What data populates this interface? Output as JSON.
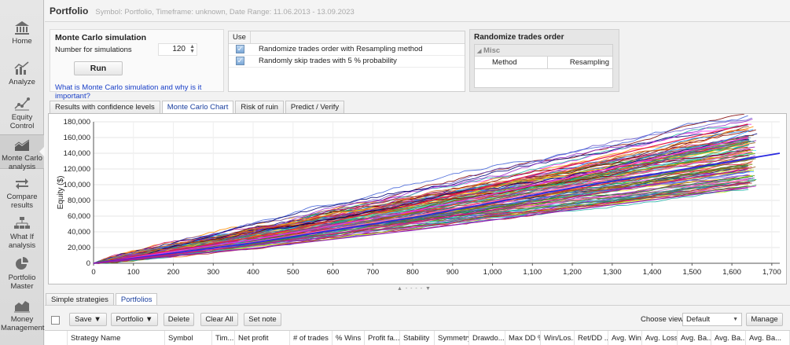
{
  "header": {
    "title": "Portfolio",
    "subtitle": "Symbol: Portfolio, Timeframe: unknown, Date Range: 11.06.2013 - 13.09.2023"
  },
  "sidebar": {
    "items": [
      {
        "label": "Home",
        "icon": "home-icon"
      },
      {
        "label": "Analyze",
        "icon": "analyze-chart-icon"
      },
      {
        "label": "Equity Control",
        "icon": "equity-control-icon"
      },
      {
        "label": "Monte Carlo analysis",
        "icon": "monte-carlo-icon",
        "active": true
      },
      {
        "label": "Compare results",
        "icon": "compare-icon"
      },
      {
        "label": "What If analysis",
        "icon": "what-if-icon"
      },
      {
        "label": "Portfolio Master",
        "icon": "pie-chart-icon"
      },
      {
        "label": "Money Management",
        "icon": "money-management-icon"
      }
    ]
  },
  "mc_panel": {
    "title": "Monte Carlo simulation",
    "sim_label": "Number for simulations",
    "sim_value": "120",
    "run_label": "Run",
    "link_text": "What is Monte Carlo simulation and why is it important?"
  },
  "use_panel": {
    "header": "Use",
    "options": [
      {
        "label": "Randomize trades order with Resampling method",
        "checked": true
      },
      {
        "label": "Randomly skip trades with 5 % probability",
        "checked": true
      }
    ]
  },
  "randomize_panel": {
    "title": "Randomize trades order",
    "group": "Misc",
    "property": "Method",
    "value": "Resampling"
  },
  "chart_tabs": [
    "Results with confidence levels",
    "Monte Carlo Chart",
    "Risk of ruin",
    "Predict / Verify"
  ],
  "active_chart_tab": "Monte Carlo Chart",
  "chart_data": {
    "type": "line",
    "title": "",
    "xlabel": "",
    "ylabel": "Equity ($)",
    "xlim": [
      0,
      1720
    ],
    "ylim": [
      0,
      180000
    ],
    "x_ticks": [
      "0",
      "100",
      "200",
      "300",
      "400",
      "500",
      "600",
      "700",
      "800",
      "900",
      "1,000",
      "1,100",
      "1,200",
      "1,300",
      "1,400",
      "1,500",
      "1,600",
      "1,700"
    ],
    "y_ticks": [
      "0",
      "20,000",
      "40,000",
      "60,000",
      "80,000",
      "100,000",
      "120,000",
      "140,000",
      "160,000",
      "180,000"
    ],
    "grid": true,
    "simulations": 120,
    "final_equity_range": [
      96000,
      177000
    ],
    "final_trade_range": [
      1640,
      1720
    ],
    "series": [
      {
        "x": [
          0,
          400,
          800,
          1200,
          1640
        ],
        "y": [
          0,
          33000,
          74000,
          125000,
          177000
        ]
      },
      {
        "x": [
          0,
          400,
          800,
          1200,
          1640
        ],
        "y": [
          0,
          30000,
          66000,
          110000,
          160000
        ]
      },
      {
        "x": [
          0,
          400,
          800,
          1200,
          1650
        ],
        "y": [
          0,
          27000,
          60000,
          98000,
          142000
        ]
      },
      {
        "x": [
          0,
          400,
          800,
          1200,
          1720
        ],
        "y": [
          0,
          26000,
          58000,
          96000,
          140000
        ]
      },
      {
        "x": [
          0,
          400,
          800,
          1200,
          1640
        ],
        "y": [
          0,
          23000,
          52000,
          84000,
          120000
        ]
      },
      {
        "x": [
          0,
          400,
          800,
          1200,
          1640
        ],
        "y": [
          0,
          19000,
          42000,
          68000,
          96000
        ]
      }
    ]
  },
  "bottom_tabs": [
    "Simple strategies",
    "Portfolios"
  ],
  "active_bottom_tab": "Portfolios",
  "toolbar": {
    "save": "Save ▼",
    "portfolio": "Portfolio ▼",
    "delete": "Delete",
    "clear_all": "Clear All",
    "set_note": "Set note",
    "choose_view": "Choose view",
    "view_value": "Default",
    "manage": "Manage"
  },
  "table_columns": [
    "Strategy Name",
    "Symbol",
    "Tim...",
    "Net profit",
    "# of trades",
    "% Wins",
    "Profit fa...",
    "Stability",
    "Symmetry",
    "Drawdo...",
    "Max DD %",
    "Win/Los...",
    "Ret/DD ...",
    "Avg. Win",
    "Avg. Loss",
    "Avg. Ba...",
    "Avg. Ba...",
    "Avg. Ba..."
  ],
  "colors": {
    "accent": "#1a3f9e",
    "link": "#1a40c8",
    "highlight_series": "#2a2ae0"
  }
}
